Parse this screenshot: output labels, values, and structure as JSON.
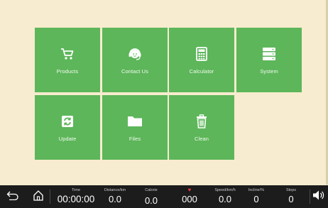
{
  "tiles": [
    {
      "label": "Products",
      "icon": "shopping-cart-icon"
    },
    {
      "label": "Contact Us",
      "icon": "headset-support-icon"
    },
    {
      "label": "Calculator",
      "icon": "calculator-icon"
    },
    {
      "label": "System",
      "icon": "server-stack-icon"
    },
    {
      "label": "Update",
      "icon": "refresh-icon"
    },
    {
      "label": "Files",
      "icon": "folder-icon"
    },
    {
      "label": "Clean",
      "icon": "trash-icon"
    }
  ],
  "bottom_bar": {
    "metrics": [
      {
        "label": "Time",
        "value": "00:00:00"
      },
      {
        "label": "Distance/km",
        "value": "0.0"
      },
      {
        "label": "Calorie",
        "value": "0.0"
      },
      {
        "label": "",
        "value": "000",
        "icon": "heart-icon"
      },
      {
        "label": "Speed/km/h",
        "value": "0.0"
      },
      {
        "label": "Incline/%",
        "value": "0"
      },
      {
        "label": "Steps",
        "value": "0"
      }
    ],
    "buttons": [
      "back-icon",
      "home-icon",
      "volume-icon"
    ]
  },
  "colors": {
    "background": "#f7eccf",
    "tile": "#5db65a",
    "bar": "#1c1c1c",
    "heart": "#e23a3a"
  }
}
